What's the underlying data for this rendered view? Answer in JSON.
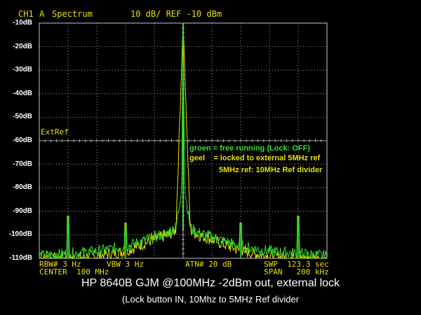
{
  "header": {
    "channel": "CH1",
    "mode": "A",
    "title": "Spectrum",
    "scale": "10 dB/ REF -10 dBm"
  },
  "y_axis": {
    "labels": [
      "-10dB",
      "-20dB",
      "-30dB",
      "-40dB",
      "-50dB",
      "-60dB",
      "-70dB",
      "-80dB",
      "-90dB",
      "-100dB",
      "-110dB"
    ]
  },
  "annotations": {
    "extref": "ExtRef",
    "legend_green": "groen = free running (Lock: OFF)",
    "legend_yellow": "geel    = locked to external 5MHz ref",
    "ref_note": "5MHz ref: 10MHz Ref divider"
  },
  "footer": {
    "rbw": "RBW# 3 Hz",
    "vbw": "VBW 3 Hz",
    "atn": "ATN# 20 dB",
    "swp": "SWP  123.3 sec",
    "center": "CENTER  100 MHz",
    "span": "SPAN   200 kHz"
  },
  "caption": {
    "line1": "HP 8640B GJM @100MHz -2dBm out,  external lock",
    "line2": "(Lock button IN, 10Mhz to 5MHz Ref divider"
  },
  "colors": {
    "grid": "#c8c8c8",
    "yellow_trace": "#e8e000",
    "green_trace": "#30e030",
    "text_yellow": "#e8e000",
    "text_green": "#30e030"
  },
  "chart_data": {
    "type": "line",
    "title": "Spectrum",
    "xlabel": "",
    "ylabel": "",
    "center_mhz": 100,
    "span_khz": 200,
    "xlim_khz": [
      -100,
      100
    ],
    "ylim_dbm": [
      -110,
      -10
    ],
    "grid": true,
    "series": [
      {
        "color": "yellow",
        "x_khz": [
          -100,
          -80,
          -60,
          -40,
          -20,
          -10,
          -5,
          0,
          5,
          10,
          20,
          40,
          60,
          80,
          100
        ],
        "y_dbm": [
          -110,
          -110,
          -109,
          -107,
          -102,
          -100,
          -98,
          -10,
          -98,
          -100,
          -102,
          -107,
          -109,
          -110,
          -110
        ]
      },
      {
        "color": "green",
        "x_khz": [
          -100,
          -80,
          -60,
          -40,
          -20,
          -10,
          -5,
          -1,
          0,
          1,
          5,
          10,
          20,
          40,
          60,
          80,
          100
        ],
        "y_dbm": [
          -109,
          -108,
          -107,
          -105,
          -101,
          -99,
          -97,
          -80,
          -10,
          -80,
          -97,
          -99,
          -101,
          -105,
          -107,
          -108,
          -109
        ]
      }
    ],
    "spurs": [
      {
        "x_khz": -80,
        "y_dbm": -92
      },
      {
        "x_khz": -40,
        "y_dbm": -95
      },
      {
        "x_khz": 40,
        "y_dbm": -95
      },
      {
        "x_khz": 80,
        "y_dbm": -92
      }
    ]
  }
}
